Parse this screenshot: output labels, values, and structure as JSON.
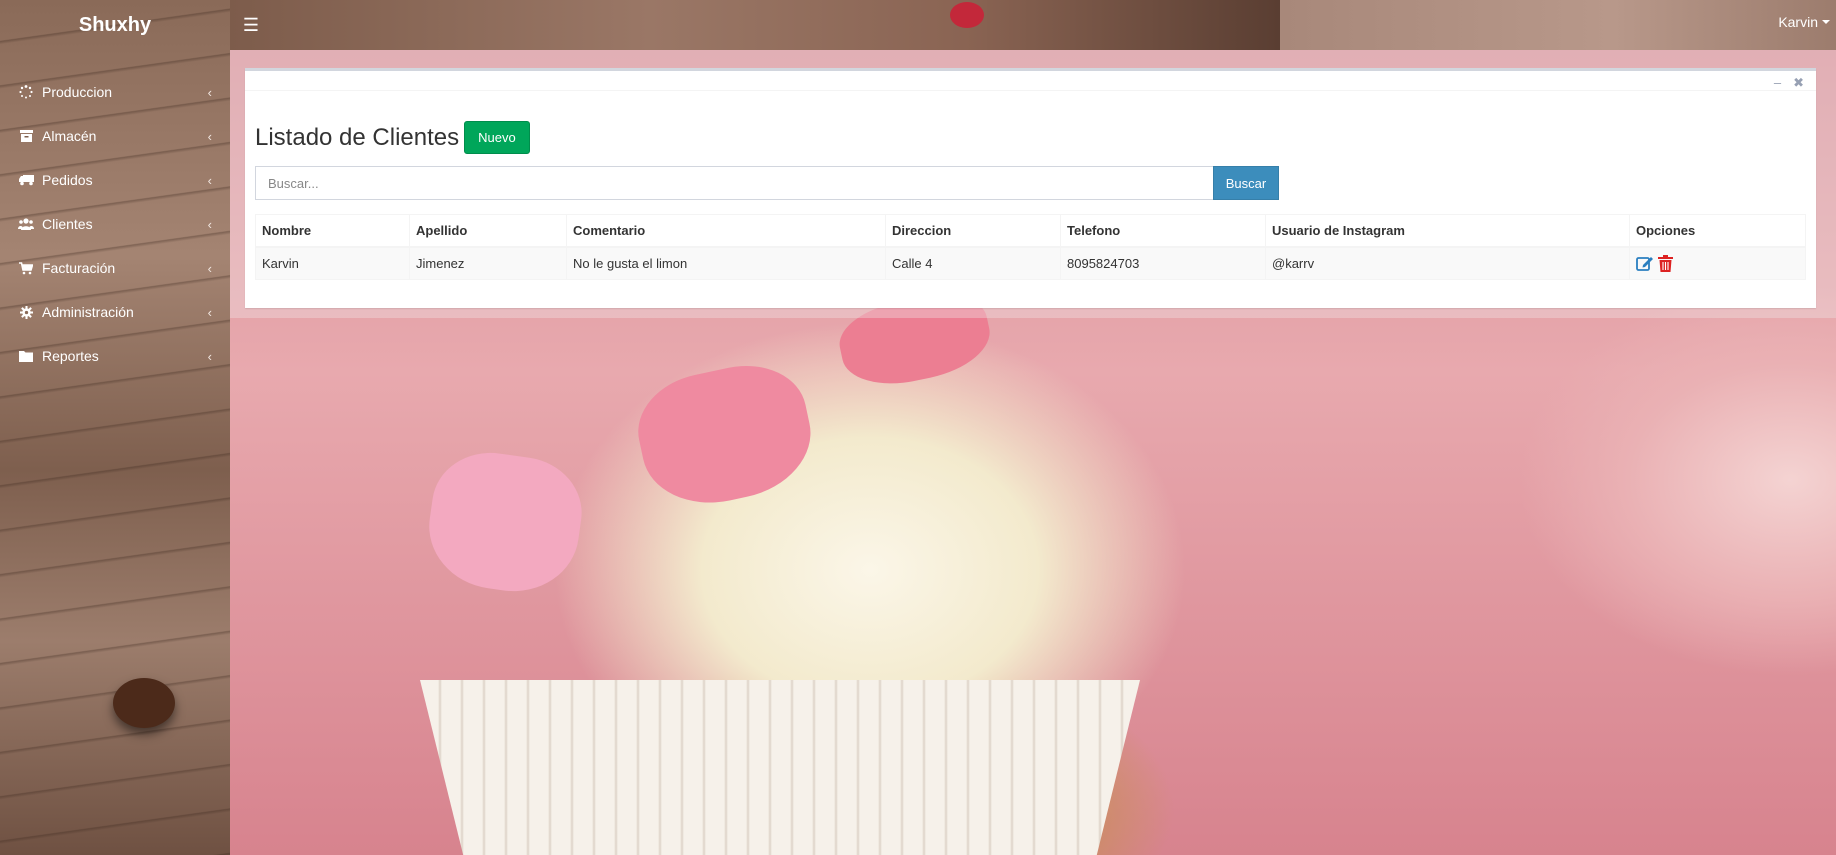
{
  "app": {
    "brand": "Shuxhy",
    "user_name": "Karvin"
  },
  "sidebar": {
    "items": [
      {
        "label": "Produccion",
        "icon": "spinner-icon"
      },
      {
        "label": "Almacén",
        "icon": "archive-icon"
      },
      {
        "label": "Pedidos",
        "icon": "truck-icon"
      },
      {
        "label": "Clientes",
        "icon": "users-icon"
      },
      {
        "label": "Facturación",
        "icon": "cart-icon"
      },
      {
        "label": "Administración",
        "icon": "gear-icon"
      },
      {
        "label": "Reportes",
        "icon": "folder-icon"
      }
    ]
  },
  "page": {
    "title": "Listado de Clientes",
    "new_button": "Nuevo",
    "search_placeholder": "Buscar...",
    "search_value": "",
    "search_button": "Buscar"
  },
  "table": {
    "headers": [
      "Nombre",
      "Apellido",
      "Comentario",
      "Direccion",
      "Telefono",
      "Usuario de Instagram",
      "Opciones"
    ],
    "rows": [
      {
        "nombre": "Karvin",
        "apellido": "Jimenez",
        "comentario": "No le gusta el limon",
        "direccion": "Calle 4",
        "telefono": "8095824703",
        "instagram": "@karrv"
      }
    ]
  },
  "colors": {
    "accent_green": "#00a65a",
    "accent_blue": "#3c8dbc",
    "delete_red": "#dd2222",
    "edit_blue": "#2a7fc0"
  }
}
